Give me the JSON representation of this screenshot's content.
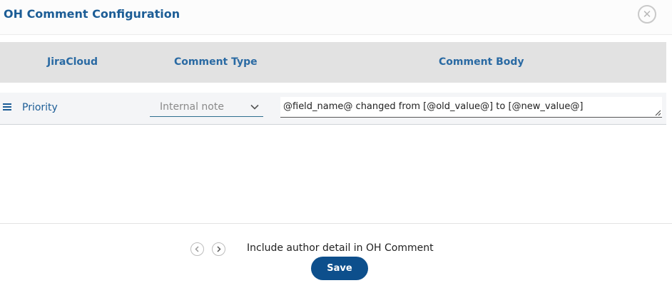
{
  "dialog": {
    "title": "OH Comment Configuration"
  },
  "table": {
    "headers": {
      "jira_cloud": "JiraCloud",
      "comment_type": "Comment Type",
      "comment_body": "Comment Body"
    },
    "rows": [
      {
        "field": "Priority",
        "comment_type": "Internal note",
        "comment_body": "@field_name@ changed from [@old_value@] to [@new_value@]"
      }
    ]
  },
  "footer": {
    "include_author_label": "Include author detail in OH Comment",
    "save_label": "Save"
  },
  "icons": {
    "close": "close-icon",
    "drag": "drag-handle-icon",
    "dropdown": "chevron-down-icon",
    "prev": "chevron-left-icon",
    "next": "chevron-right-icon"
  },
  "colors": {
    "title": "#1c5d96",
    "header_bg": "#e2e2e2",
    "header_text": "#2a6aa3",
    "button_bg": "#0d4f8c"
  }
}
